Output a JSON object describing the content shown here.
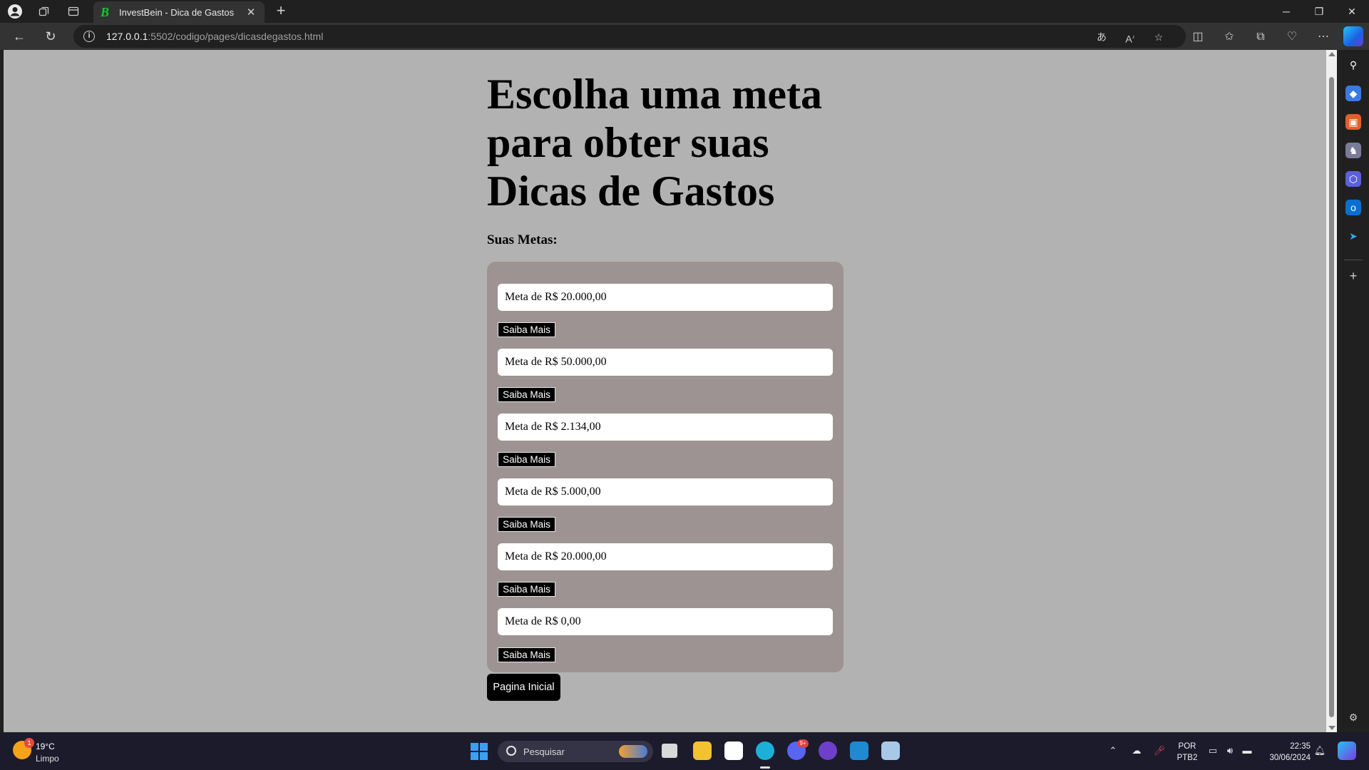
{
  "browser": {
    "tab_title": "InvestBein - Dica de Gastos",
    "tab_favicon": "B",
    "url_host": "127.0.0.1",
    "url_rest": ":5502/codigo/pages/dicasdegastos.html"
  },
  "page": {
    "title": "Escolha uma meta para obter suas Dicas de Gastos",
    "section_label": "Suas Metas:",
    "goals": [
      {
        "label": "Meta de R$ 20.000,00",
        "button": "Saiba Mais"
      },
      {
        "label": "Meta de R$ 50.000,00",
        "button": "Saiba Mais"
      },
      {
        "label": "Meta de R$ 2.134,00",
        "button": "Saiba Mais"
      },
      {
        "label": "Meta de R$ 5.000,00",
        "button": "Saiba Mais"
      },
      {
        "label": "Meta de R$ 20.000,00",
        "button": "Saiba Mais"
      },
      {
        "label": "Meta de R$ 0,00",
        "button": "Saiba Mais"
      }
    ],
    "home_button": "Pagina Inicial"
  },
  "taskbar": {
    "weather_badge": "1",
    "weather_temp": "19°C",
    "weather_desc": "Limpo",
    "search_placeholder": "Pesquisar",
    "discord_badge": "9+",
    "lang_top": "POR",
    "lang_bottom": "PTB2",
    "time": "22:35",
    "date": "30/06/2024"
  },
  "colors": {
    "page_background": "#b2b2b2",
    "goals_panel": "#9e9393",
    "button_black": "#000000",
    "favicon_green": "#12c92a"
  }
}
